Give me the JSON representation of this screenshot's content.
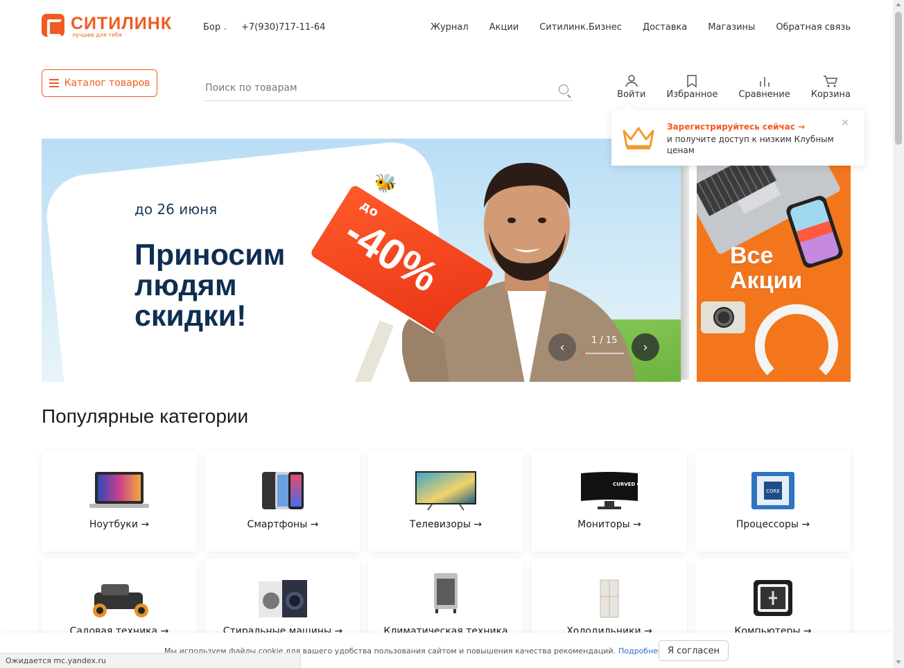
{
  "header": {
    "logo_name": "СИТИЛИНК",
    "logo_slogan": "лучшее для тебя",
    "city": "Бор",
    "phone": "+7(930)717-11-64",
    "nav": [
      "Журнал",
      "Акции",
      "Ситилинк.Бизнес",
      "Доставка",
      "Магазины",
      "Обратная связь"
    ]
  },
  "toolbar": {
    "catalog_label": "Каталог товаров",
    "search_placeholder": "Поиск по товарам",
    "login": "Войти",
    "favorites": "Избранное",
    "compare": "Сравнение",
    "cart": "Корзина"
  },
  "popup": {
    "link": "Зарегистрируйтесь сейчас →",
    "text": "и получите доступ к низким Клубным ценам",
    "close": "×"
  },
  "hero": {
    "date": "до 26 июня",
    "headline_1": "Приносим",
    "headline_2": "людям",
    "headline_3": "скидки!",
    "sign_prefix": "до",
    "sign_value": "-40%",
    "counter": "1 / 15",
    "prev": "‹",
    "next": "›"
  },
  "side_banner": {
    "title_1": "Все",
    "title_2": "Акции"
  },
  "categories": {
    "title": "Популярные категории",
    "items": [
      "Ноутбуки →",
      "Смартфоны →",
      "Телевизоры →",
      "Мониторы →",
      "Процессоры →",
      "Садовая техника →",
      "Стиральные машины →",
      "Климатическая техника",
      "Холодильники →",
      "Компьютеры →"
    ],
    "monitor_print": "CURVED GAMING MONITOR",
    "cpu_print": "CORE"
  },
  "cookie": {
    "text": "Мы используем файлы cookie для вашего удобства пользования сайтом и повышения качества рекомендаций.",
    "more": "Подробнее",
    "agree": "Я согласен"
  },
  "status_bar": "Ожидается mc.yandex.ru",
  "colors": {
    "brand": "#f25a1f",
    "hero_text": "#0e2e52"
  }
}
